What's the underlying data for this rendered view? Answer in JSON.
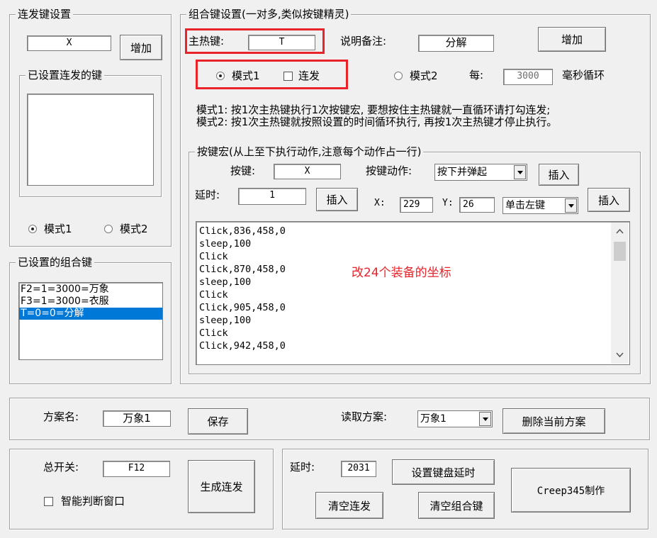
{
  "burst": {
    "title": "连发键设置",
    "key_value": "X",
    "add_button": "增加",
    "configured_title": "已设置连发的键",
    "configured_items": [],
    "mode1": "模式1",
    "mode2": "模式2"
  },
  "combo_list": {
    "title": "已设置的组合键",
    "items": [
      "F2=1=3000=万象",
      "F3=1=3000=衣服",
      "T=0=0=分解"
    ],
    "selected_index": 2
  },
  "combo": {
    "title": "组合键设置(一对多,类似按键精灵)",
    "hotkey_label": "主热键:",
    "hotkey_value": "T",
    "note_label": "说明备注:",
    "note_value": "分解",
    "add_button": "增加",
    "mode1": "模式1",
    "loop_label": "连发",
    "mode2": "模式2",
    "every_label": "每:",
    "interval_value": "3000",
    "ms_label": "毫秒循环",
    "desc1": "模式1: 按1次主热键执行1次按键宏, 要想按住主热键就一直循环请打勾连发;",
    "desc2": "模式2: 按1次主热键就按照设置的时间循环执行, 再按1次主热键才停止执行。"
  },
  "macro": {
    "title": "按键宏(从上至下执行动作,注意每个动作占一行)",
    "key_label": "按键:",
    "key_value": "X",
    "action_label": "按键动作:",
    "action_value": "按下并弹起",
    "insert1": "插入",
    "delay_label": "延时:",
    "delay_value": "1",
    "insert2": "插入",
    "x_label": "X:",
    "x_value": "229",
    "y_label": "Y:",
    "y_value": "26",
    "click_value": "单击左键",
    "insert3": "插入",
    "lines": [
      "Click,836,458,0",
      "sleep,100",
      "Click",
      "Click,870,458,0",
      "sleep,100",
      "Click",
      "Click,905,458,0",
      "sleep,100",
      "Click",
      "Click,942,458,0"
    ],
    "annotation": "改24个装备的坐标"
  },
  "scheme": {
    "name_label": "方案名:",
    "name_value": "万象1",
    "save_button": "保存",
    "read_label": "读取方案:",
    "read_value": "万象1",
    "delete_button": "删除当前方案"
  },
  "master": {
    "switch_label": "总开关:",
    "switch_value": "F12",
    "generate_button": "生成连发",
    "smart_label": "智能判断窗口"
  },
  "timing": {
    "delay_label": "延时:",
    "delay_value": "2031",
    "set_delay_button": "设置键盘延时",
    "clear_burst_button": "清空连发",
    "clear_combo_button": "清空组合键",
    "credit_button": "Creep345制作"
  },
  "colors": {
    "highlight_box": "#e8232a",
    "annotation_text": "#e8232a",
    "selection": "#0078d7"
  }
}
